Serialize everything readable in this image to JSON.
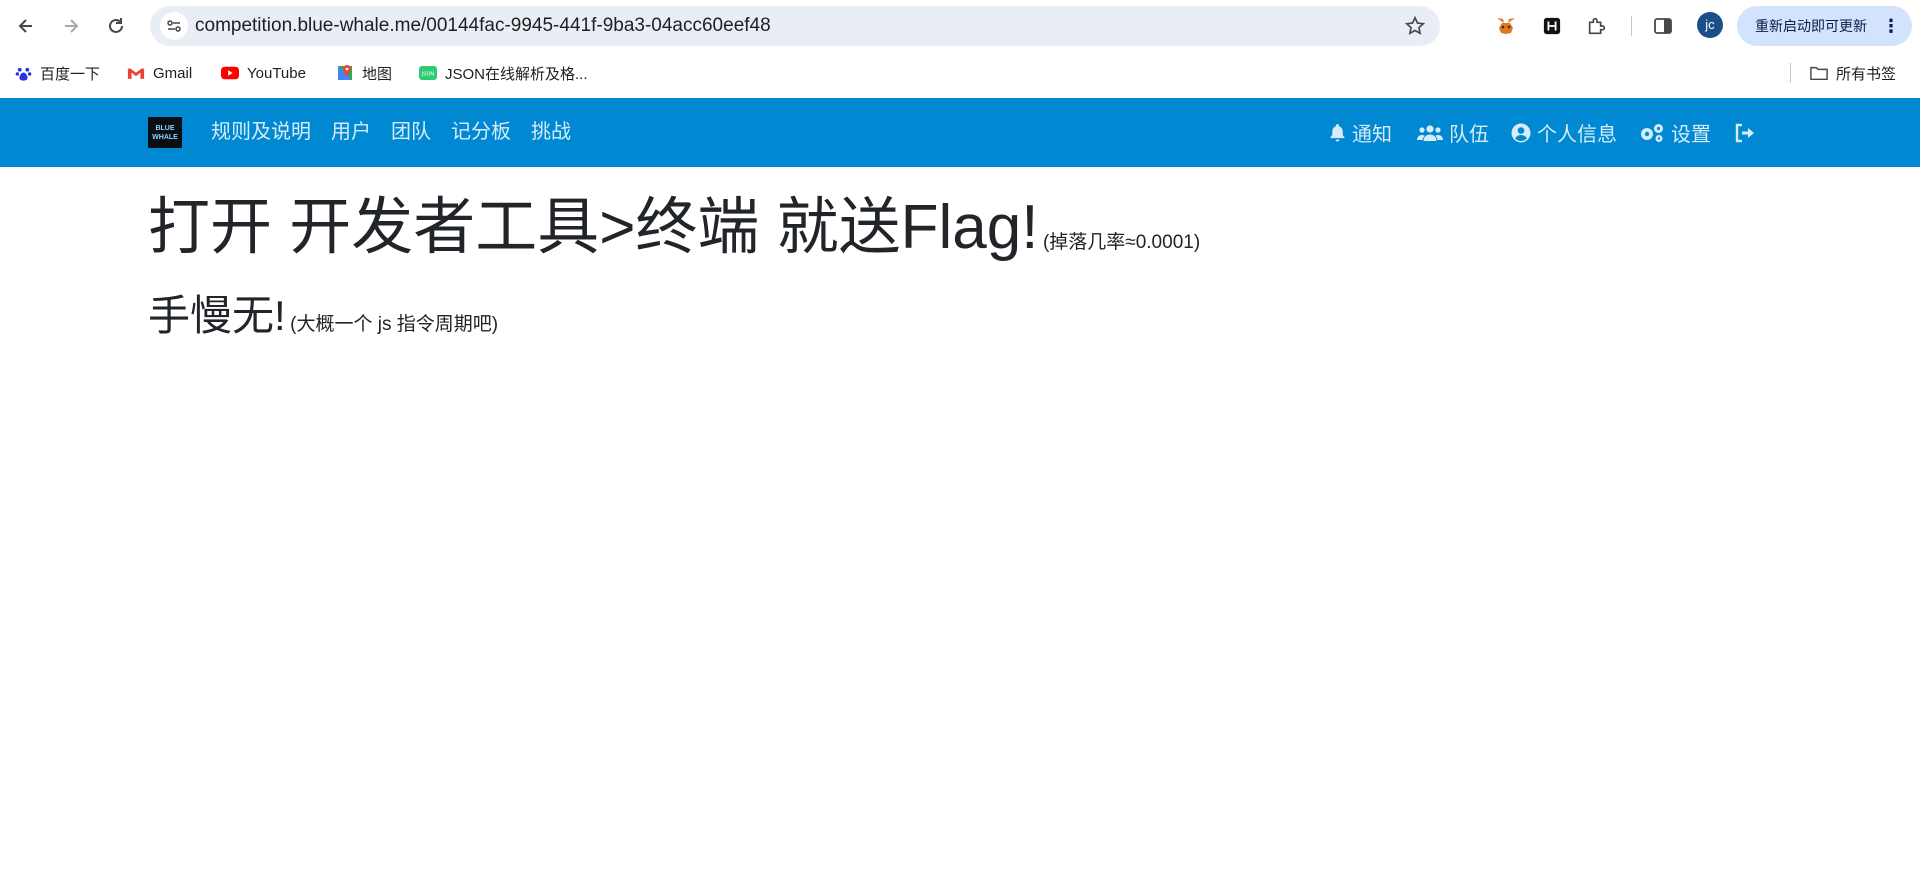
{
  "browser": {
    "url": "competition.blue-whale.me/00144fac-9945-441f-9ba3-04acc60eef48",
    "avatar_text": "jc",
    "update_button": "重新启动即可更新",
    "bookmarks": [
      {
        "label": "百度一下",
        "icon": "baidu-paw-icon"
      },
      {
        "label": "Gmail",
        "icon": "gmail-icon"
      },
      {
        "label": "YouTube",
        "icon": "youtube-icon"
      },
      {
        "label": "地图",
        "icon": "maps-icon"
      },
      {
        "label": "JSON在线解析及格...",
        "icon": "json-icon"
      }
    ],
    "all_bookmarks": "所有书签"
  },
  "site_nav": {
    "logo_text": "BLUE WHALE",
    "links": [
      "规则及说明",
      "用户",
      "团队",
      "记分板",
      "挑战"
    ],
    "right": {
      "notifications": "通知",
      "team": "队伍",
      "profile": "个人信息",
      "settings": "设置"
    },
    "color": "#0088d2"
  },
  "content": {
    "headline": "打开 开发者工具>终端 就送Flag!",
    "headline_note": "(掉落几率≈0.0001)",
    "subline": "手慢无!",
    "subline_note": "(大概一个 js 指令周期吧)"
  }
}
